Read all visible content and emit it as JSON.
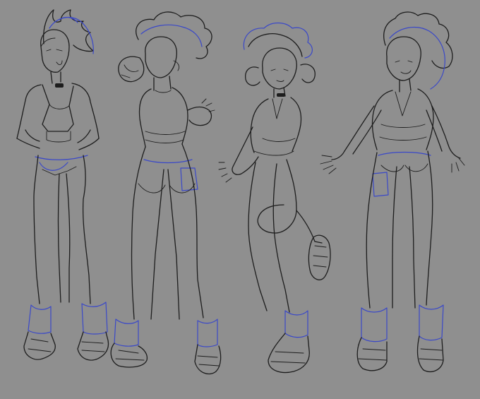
{
  "colors": {
    "background": "#8f8f8f",
    "line_art": "#1d1d1d",
    "construction_lines": "#3a48c8"
  },
  "figures": [
    {
      "id": "figure-1",
      "pose": "front-hands-on-hips"
    },
    {
      "id": "figure-2",
      "pose": "back-view-looking-over-shoulder"
    },
    {
      "id": "figure-3",
      "pose": "side-view-knee-raised"
    },
    {
      "id": "figure-4",
      "pose": "front-arms-out"
    }
  ]
}
